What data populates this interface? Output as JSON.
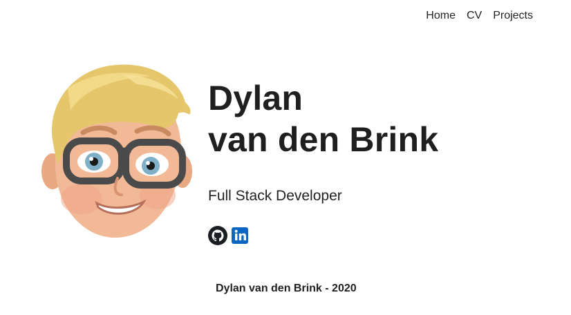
{
  "nav": {
    "items": [
      {
        "label": "Home"
      },
      {
        "label": "CV"
      },
      {
        "label": "Projects"
      }
    ]
  },
  "hero": {
    "name_line1": "Dylan",
    "name_line2": "van den Brink",
    "role": "Full Stack Developer"
  },
  "socials": [
    {
      "icon": "github-icon",
      "color": "#1b1f23"
    },
    {
      "icon": "linkedin-icon",
      "color": "#0a66c2"
    }
  ],
  "avatar": {
    "icon": "memoji-avatar"
  },
  "footer": {
    "text": "Dylan van den Brink - 2020"
  }
}
